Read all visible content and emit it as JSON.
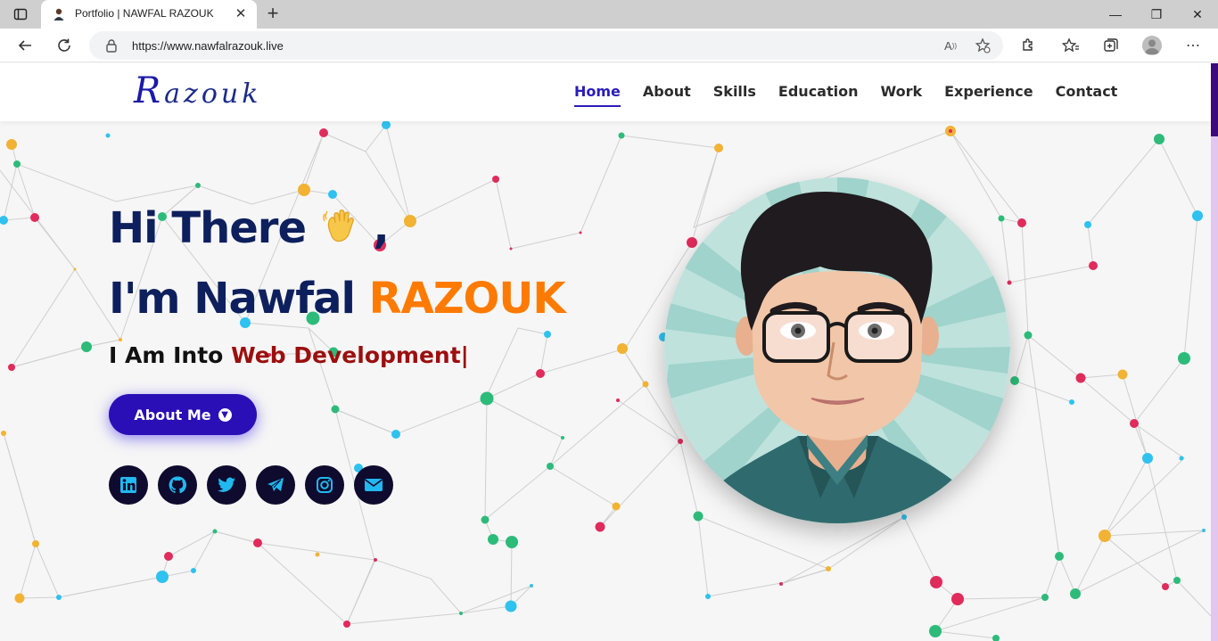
{
  "browser": {
    "tab_title": "Portfolio | NAWFAL RAZOUK",
    "url": "https://www.nawfalrazouk.live"
  },
  "site": {
    "logo_initial": "R",
    "logo_rest": "azouk",
    "nav": [
      {
        "label": "Home",
        "active": true
      },
      {
        "label": "About",
        "active": false
      },
      {
        "label": "Skills",
        "active": false
      },
      {
        "label": "Education",
        "active": false
      },
      {
        "label": "Work",
        "active": false
      },
      {
        "label": "Experience",
        "active": false
      },
      {
        "label": "Contact",
        "active": false
      }
    ]
  },
  "hero": {
    "greeting": "Hi There",
    "greeting_suffix": ",",
    "intro": "I'm Nawfal",
    "name": "RAZOUK",
    "typed_prefix": "I Am Into",
    "typed_value": "Web Development|",
    "cta_label": "About Me"
  },
  "socials": [
    "linkedin-icon",
    "github-icon",
    "twitter-icon",
    "telegram-icon",
    "instagram-icon",
    "mail-icon"
  ],
  "colors": {
    "brand": "#2a0fb6",
    "title": "#0d1f5c",
    "name_accent": "#ff7a00",
    "typed_accent": "#9b0f0f",
    "social_bg": "#0e0b2e",
    "social_icon": "#22b8f0"
  }
}
